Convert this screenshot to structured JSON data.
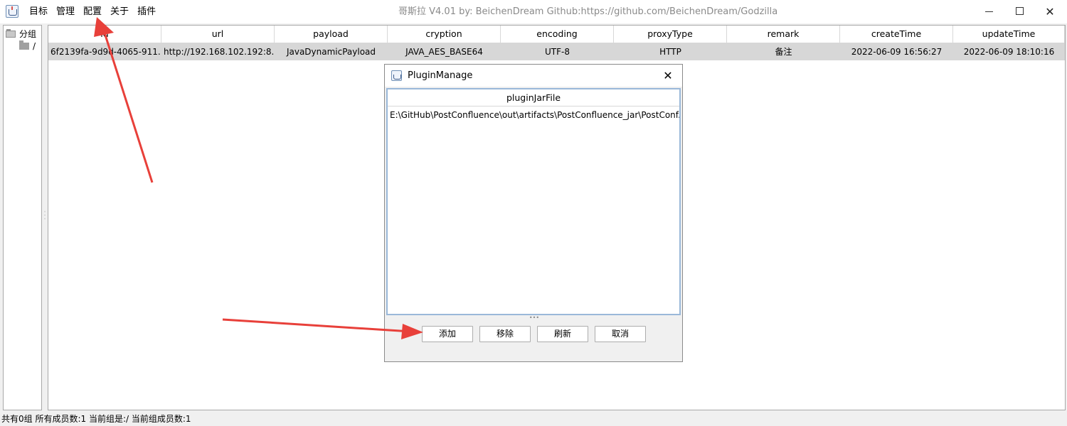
{
  "window": {
    "title": "哥斯拉   V4.01 by: BeichenDream Github:https://github.com/BeichenDream/Godzilla",
    "minimize": "",
    "maximize": "",
    "close": "✕"
  },
  "menu": [
    {
      "label": "目标"
    },
    {
      "label": "管理"
    },
    {
      "label": "配置"
    },
    {
      "label": "关于"
    },
    {
      "label": "插件"
    }
  ],
  "tree": {
    "root": "分组",
    "child": "/"
  },
  "table": {
    "columns": [
      "id",
      "url",
      "payload",
      "cryption",
      "encoding",
      "proxyType",
      "remark",
      "createTime",
      "updateTime"
    ],
    "rows": [
      [
        "6f2139fa-9d9d-4065-911...",
        "http://192.168.102.192:8...",
        "JavaDynamicPayload",
        "JAVA_AES_BASE64",
        "UTF-8",
        "HTTP",
        "备注",
        "2022-06-09 16:56:27",
        "2022-06-09 18:10:16"
      ]
    ]
  },
  "status": "共有0组 所有成员数:1 当前组是:/ 当前组成员数:1",
  "dialog": {
    "title": "PluginManage",
    "close": "✕",
    "column": "pluginJarFile",
    "rows": [
      "E:\\GitHub\\PostConfluence\\out\\artifacts\\PostConfluence_jar\\PostConf..."
    ],
    "buttons": {
      "add": "添加",
      "remove": "移除",
      "refresh": "刷新",
      "cancel": "取消"
    }
  },
  "colors": {
    "arrow": "#e8403a",
    "selection": "#d7d7d7",
    "list_border": "#9ab8d9"
  }
}
